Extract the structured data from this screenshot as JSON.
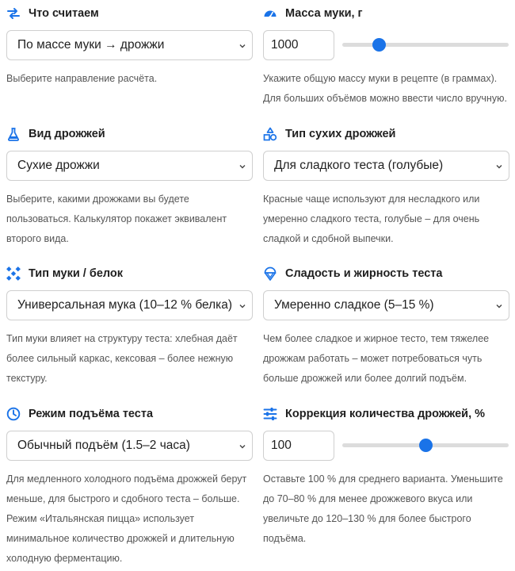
{
  "fields": {
    "what": {
      "label": "Что считаем",
      "icon": "swap-arrows-icon",
      "value": "По массе муки → дрожжи",
      "help": "Выберите направление расчёта."
    },
    "flour_mass": {
      "label": "Масса муки, г",
      "icon": "speedometer-icon",
      "value": "1000",
      "slider_fraction": 0.22,
      "help": "Укажите общую массу муки в рецепте (в граммах). Для больших объёмов можно ввести число вручную."
    },
    "yeast_kind": {
      "label": "Вид дрожжей",
      "icon": "flask-icon",
      "value": "Сухие дрожжи",
      "help": "Выберите, какими дрожжами вы будете пользоваться. Калькулятор покажет эквивалент второго вида."
    },
    "dry_yeast_type": {
      "label": "Тип сухих дрожжей",
      "icon": "shapes-icon",
      "value": "Для сладкого теста (голубые)",
      "help": "Красные чаще используют для несладкого или умеренно сладкого теста, голубые – для очень сладкой и сдобной выпечки."
    },
    "flour_type": {
      "label": "Тип муки / белок",
      "icon": "grid-cross-icon",
      "value": "Универсальная мука (10–12 % белка)",
      "help": "Тип муки влияет на структуру теста: хлебная даёт более сильный каркас, кексовая – более нежную текстуру."
    },
    "sweetness": {
      "label": "Сладость и жирность теста",
      "icon": "ice-cream-icon",
      "value": "Умеренно сладкое (5–15 %)",
      "help": "Чем более сладкое и жирное тесто, тем тяжелее дрожжам работать – может потребоваться чуть больше дрожжей или более долгий подъём."
    },
    "rise_mode": {
      "label": "Режим подъёма теста",
      "icon": "clock-icon",
      "value": "Обычный подъём (1.5–2 часа)",
      "help": "Для медленного холодного подъёма дрожжей берут меньше, для быстрого и сдобного теста – больше. Режим «Итальянская пицца» использует минимальное количество дрожжей и длительную холодную ферментацию."
    },
    "correction": {
      "label": "Коррекция количества дрожжей, %",
      "icon": "sliders-icon",
      "value": "100",
      "slider_fraction": 0.5,
      "help": "Оставьте 100 % для среднего варианта. Уменьшите до 70–80 % для менее дрожжевого вкуса или увеличьте до 120–130 % для более быстрого подъёма."
    }
  },
  "colors": {
    "accent": "#1a73e8",
    "help_text": "#555555",
    "border": "#cfcfcf",
    "track": "#dcdcdc"
  }
}
